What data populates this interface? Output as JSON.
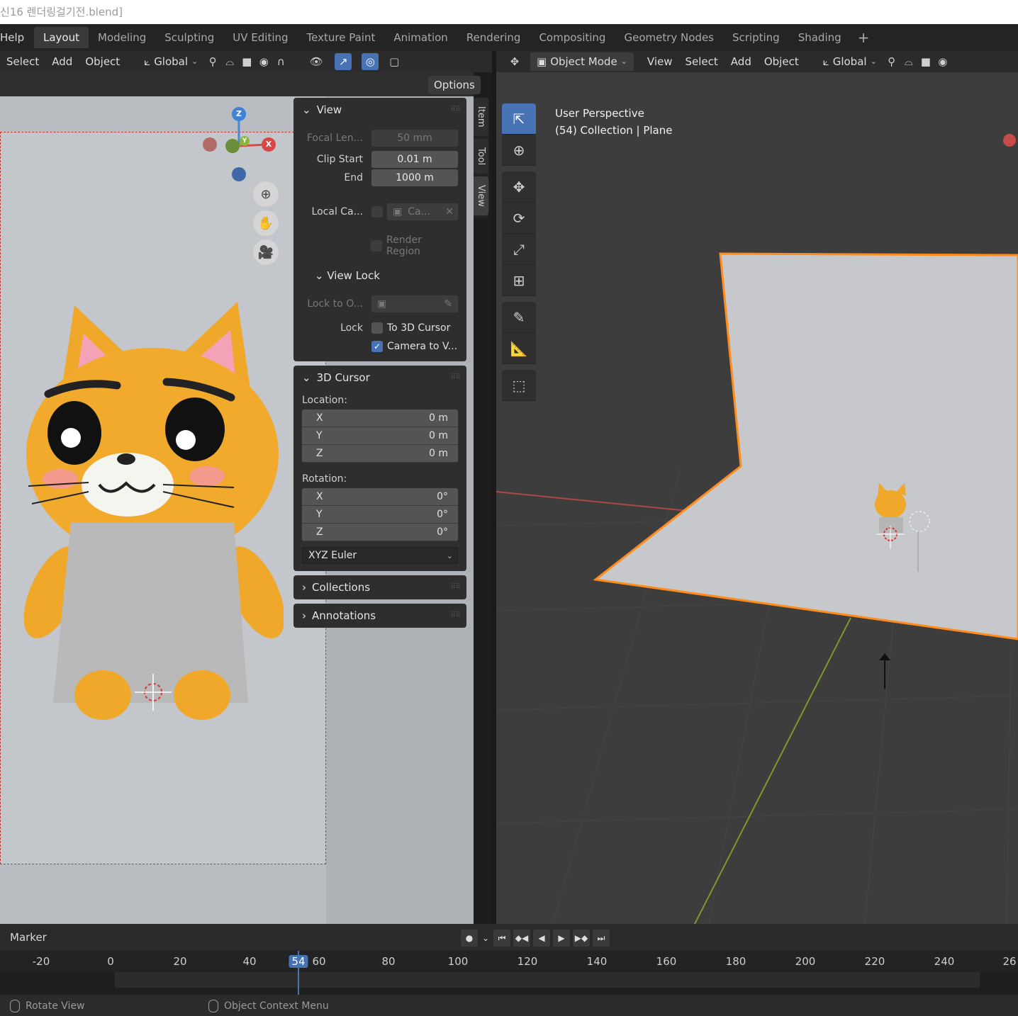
{
  "window": {
    "title": "신16 렌더링걸기전.blend]"
  },
  "menu": {
    "help": "Help"
  },
  "workspaces": [
    "Layout",
    "Modeling",
    "Sculpting",
    "UV Editing",
    "Texture Paint",
    "Animation",
    "Rendering",
    "Compositing",
    "Geometry Nodes",
    "Scripting",
    "Shading"
  ],
  "left_header": {
    "select": "Select",
    "add": "Add",
    "object": "Object",
    "orientation": "Global",
    "options": "Options"
  },
  "right_header": {
    "mode": "Object Mode",
    "view": "View",
    "select": "Select",
    "add": "Add",
    "object": "Object",
    "orientation": "Global"
  },
  "gizmo": {
    "z": "Z",
    "x": "X",
    "y": "Y"
  },
  "npanel": {
    "view_title": "View",
    "focal_label": "Focal Len...",
    "focal_value": "50 mm",
    "clip_start_label": "Clip Start",
    "clip_start_value": "0.01 m",
    "clip_end_label": "End",
    "clip_end_value": "1000 m",
    "local_cam_label": "Local Ca...",
    "local_cam_value": "Ca...",
    "render_region": "Render Region",
    "view_lock_title": "View Lock",
    "lock_to_label": "Lock to O...",
    "lock_label": "Lock",
    "to_3d_cursor": "To 3D Cursor",
    "camera_to_view": "Camera to V...",
    "cursor_title": "3D Cursor",
    "location_label": "Location:",
    "loc": [
      {
        "axis": "X",
        "value": "0 m"
      },
      {
        "axis": "Y",
        "value": "0 m"
      },
      {
        "axis": "Z",
        "value": "0 m"
      }
    ],
    "rotation_label": "Rotation:",
    "rot": [
      {
        "axis": "X",
        "value": "0°"
      },
      {
        "axis": "Y",
        "value": "0°"
      },
      {
        "axis": "Z",
        "value": "0°"
      }
    ],
    "rotation_mode": "XYZ Euler",
    "collections_title": "Collections",
    "annotations_title": "Annotations"
  },
  "sidetabs": [
    "Item",
    "Tool",
    "View"
  ],
  "viewport_info": {
    "line1": "User Perspective",
    "line2": "(54) Collection | Plane"
  },
  "timeline": {
    "marker": "Marker",
    "current_frame": "54",
    "ticks": [
      "-20",
      "0",
      "20",
      "40",
      "60",
      "80",
      "100",
      "120",
      "140",
      "160",
      "180",
      "200",
      "220",
      "240",
      "26"
    ]
  },
  "status": {
    "left": "Rotate View",
    "middle": "Object Context Menu"
  },
  "colors": {
    "accent": "#4772b3",
    "cat": "#f0a82a",
    "selection": "#ff8c1a"
  }
}
